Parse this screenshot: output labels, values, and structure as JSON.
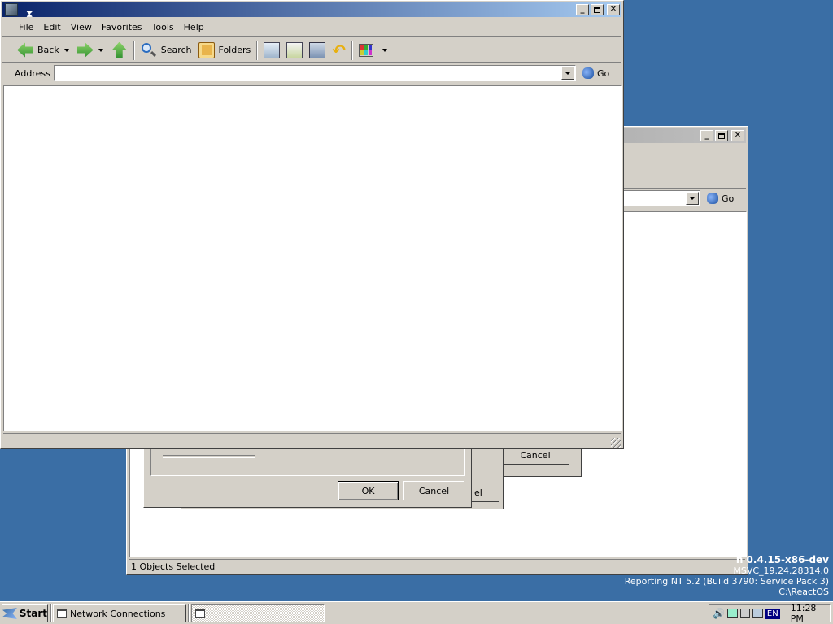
{
  "main_window": {
    "menu": [
      "File",
      "Edit",
      "View",
      "Favorites",
      "Tools",
      "Help"
    ],
    "toolbar": {
      "back": "Back",
      "search": "Search",
      "folders": "Folders"
    },
    "address_label": "Address",
    "address_value": "",
    "go": "Go"
  },
  "back_window": {
    "go": "Go",
    "status": "1 Objects Selected"
  },
  "dialogs": {
    "ok": "OK",
    "cancel": "Cancel",
    "cancel_partial": "el"
  },
  "watermark": {
    "line1": "n 0.4.15-x86-dev",
    "line2": "MSVC_19.24.28314.0",
    "line3": "Reporting NT 5.2 (Build 3790: Service Pack 3)",
    "line4": "C:\\ReactOS"
  },
  "taskbar": {
    "start": "Start",
    "task1": "Network Connections",
    "task2": "",
    "lang": "EN",
    "clock": "11:28 PM"
  },
  "colors": {
    "desktop": "#3a6ea5",
    "titlebar_active": "#0a246a",
    "titlebar_inactive": "#808080"
  }
}
